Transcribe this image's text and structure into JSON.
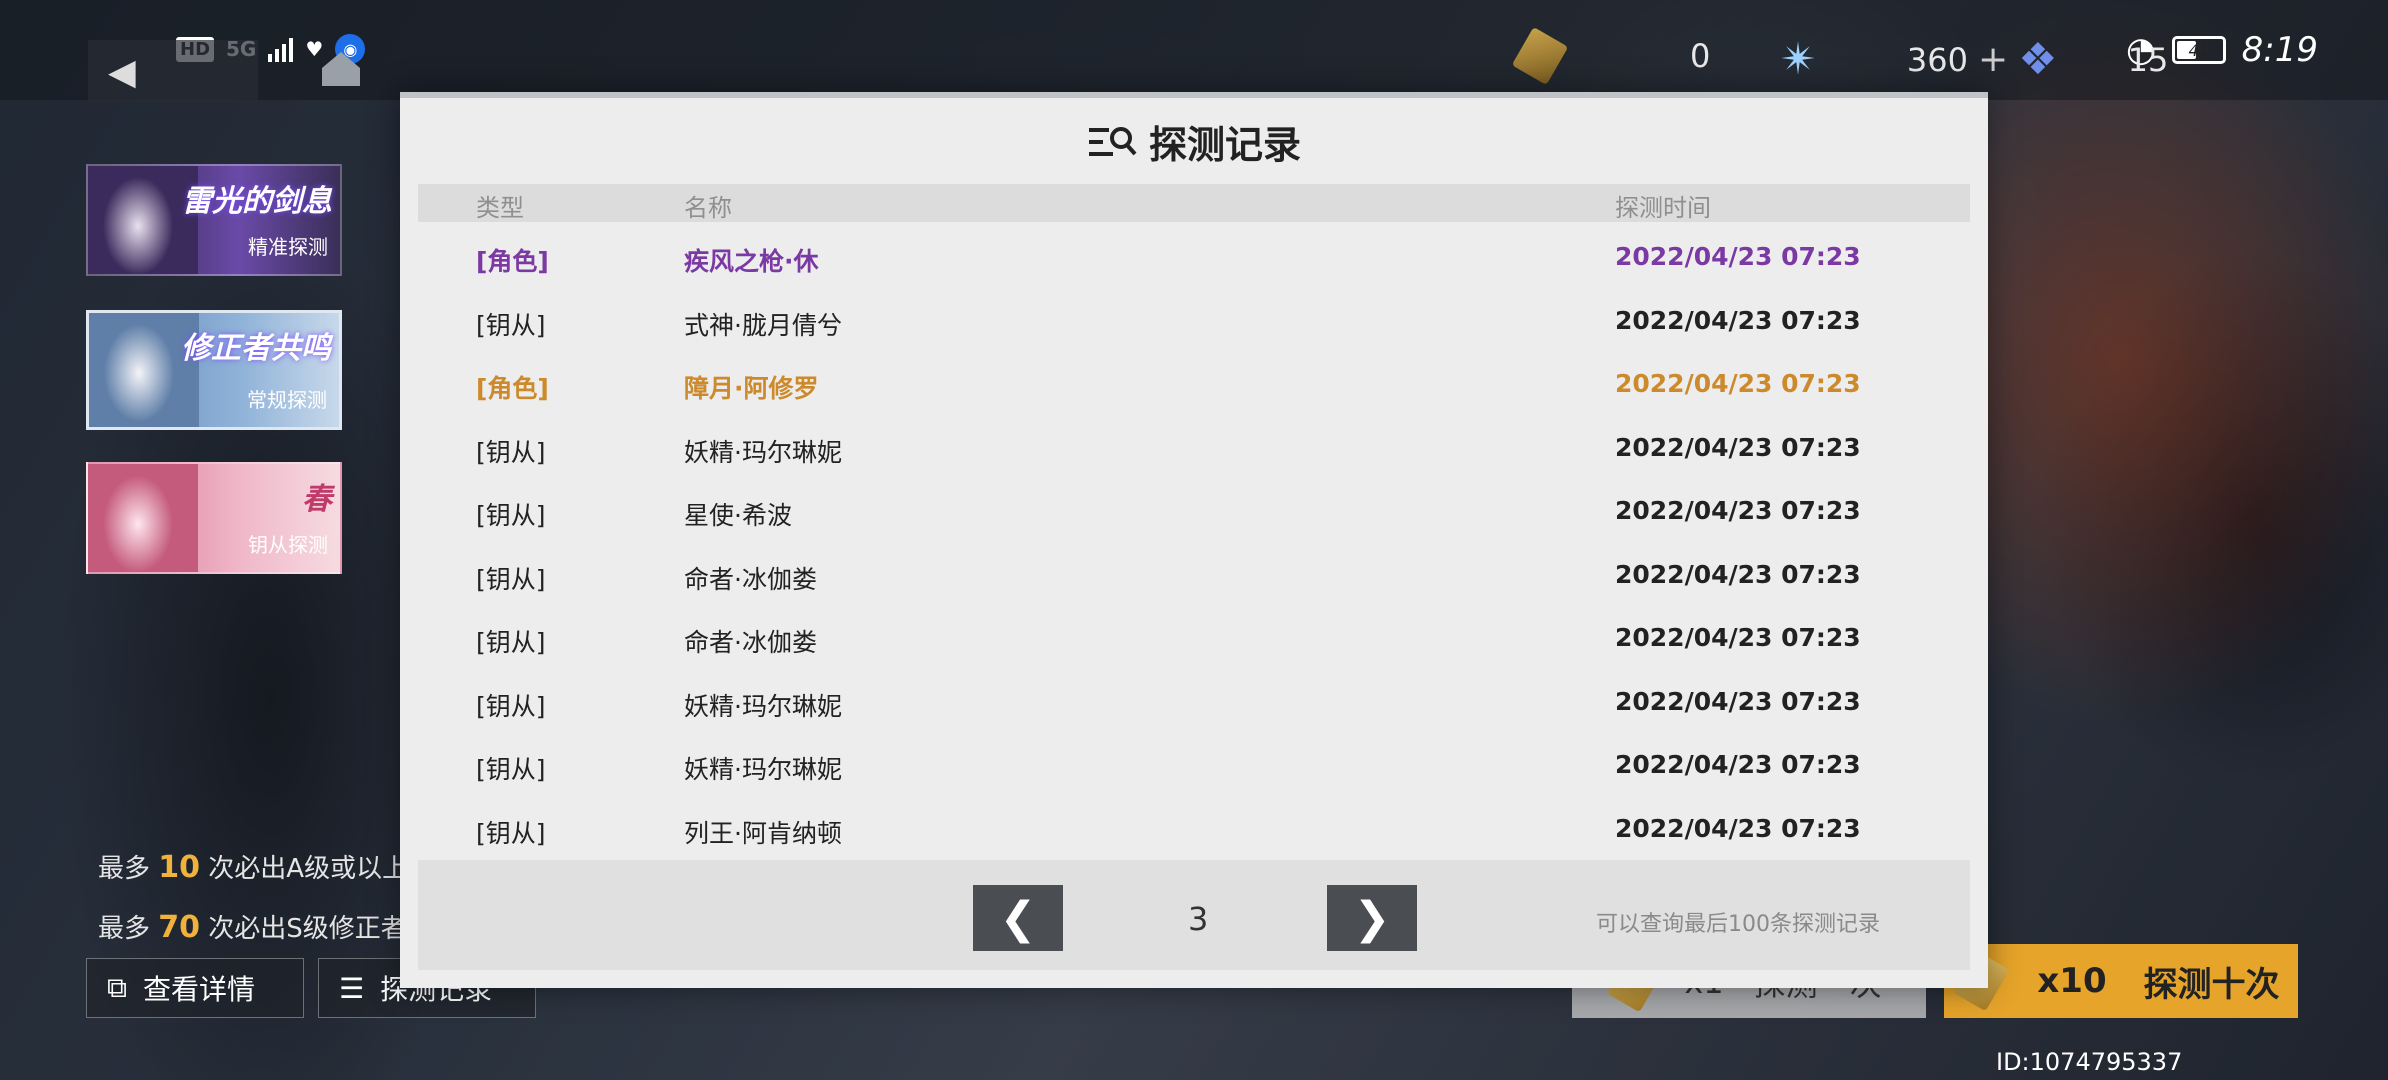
{
  "status_bar": {
    "hd": "HD",
    "network": "5G",
    "time": "8:19",
    "battery": "41"
  },
  "top_bar": {
    "currency_1": "0",
    "currency_2": "360",
    "currency_3": "15"
  },
  "banners": [
    {
      "title": "雷光的剑息",
      "subtitle": "精准探测"
    },
    {
      "title": "修正者共鸣",
      "subtitle": "常规探测"
    },
    {
      "title": "春",
      "subtitle": "钥从探测"
    }
  ],
  "info": {
    "line1_prefix": "最多",
    "line1_num": "10",
    "line1_suffix": "次必出A级或以上",
    "line2_prefix": "最多",
    "line2_num": "70",
    "line2_suffix": "次必出S级修正者"
  },
  "buttons": {
    "details": "查看详情",
    "records": "探测记录",
    "once_count": "x1",
    "once_label": "探测一次",
    "ten_count": "x10",
    "ten_label": "探测十次"
  },
  "user_id": "ID:1074795337",
  "modal": {
    "title": "探测记录",
    "headers": {
      "type": "类型",
      "name": "名称",
      "time": "探测时间"
    },
    "rows": [
      {
        "type": "[角色]",
        "name": "疾风之枪·休",
        "time": "2022/04/23 07:23"
      },
      {
        "type": "[钥从]",
        "name": "式神·胧月倩兮",
        "time": "2022/04/23 07:23"
      },
      {
        "type": "[角色]",
        "name": "障月·阿修罗",
        "time": "2022/04/23 07:23"
      },
      {
        "type": "[钥从]",
        "name": "妖精·玛尔琳妮",
        "time": "2022/04/23 07:23"
      },
      {
        "type": "[钥从]",
        "name": "星使·希波",
        "time": "2022/04/23 07:23"
      },
      {
        "type": "[钥从]",
        "name": "命者·冰伽娄",
        "time": "2022/04/23 07:23"
      },
      {
        "type": "[钥从]",
        "name": "命者·冰伽娄",
        "time": "2022/04/23 07:23"
      },
      {
        "type": "[钥从]",
        "name": "妖精·玛尔琳妮",
        "time": "2022/04/23 07:23"
      },
      {
        "type": "[钥从]",
        "name": "妖精·玛尔琳妮",
        "time": "2022/04/23 07:23"
      },
      {
        "type": "[钥从]",
        "name": "列王·阿肯纳顿",
        "time": "2022/04/23 07:23"
      }
    ],
    "page": "3",
    "prev": "❮",
    "next": "❯",
    "note": "可以查询最后100条探测记录"
  }
}
